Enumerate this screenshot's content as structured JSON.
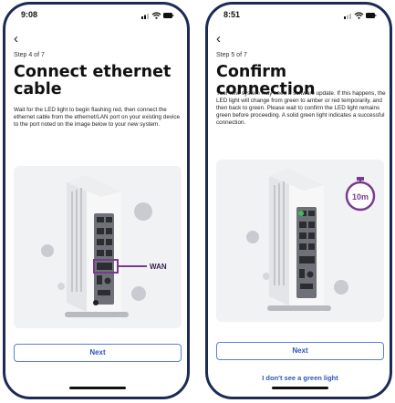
{
  "screens": [
    {
      "time": "9:08",
      "step": "Step 4 of 7",
      "title": "Connect ethernet cable",
      "body": "Wait for the LED light to begin flashing red, then connect the ethernet cable from the ethernet/LAN port on your existing device to the port noted on the image below to your new system.",
      "image_label": "WAN",
      "button": "Next"
    },
    {
      "time": "8:51",
      "step": "Step 5 of 7",
      "title": "Confirm connection",
      "body": "Your new system may need a software update. If this happens, the LED light will change from green to amber or red temporarily, and then back to green. Please wait to confirm the LED light remains green before proceeding. A solid green light indicates a successful connection.",
      "timer_label": "10m",
      "button": "Next",
      "link": "I don't see a green light"
    }
  ],
  "colors": {
    "frame": "#1d2a55",
    "accent": "#2f55b8",
    "callout_purple": "#7a3b8f",
    "led_green": "#3fbf5f"
  },
  "icons": [
    "back-arrow-icon",
    "signal-icon",
    "wifi-icon",
    "battery-icon",
    "timer-icon"
  ]
}
